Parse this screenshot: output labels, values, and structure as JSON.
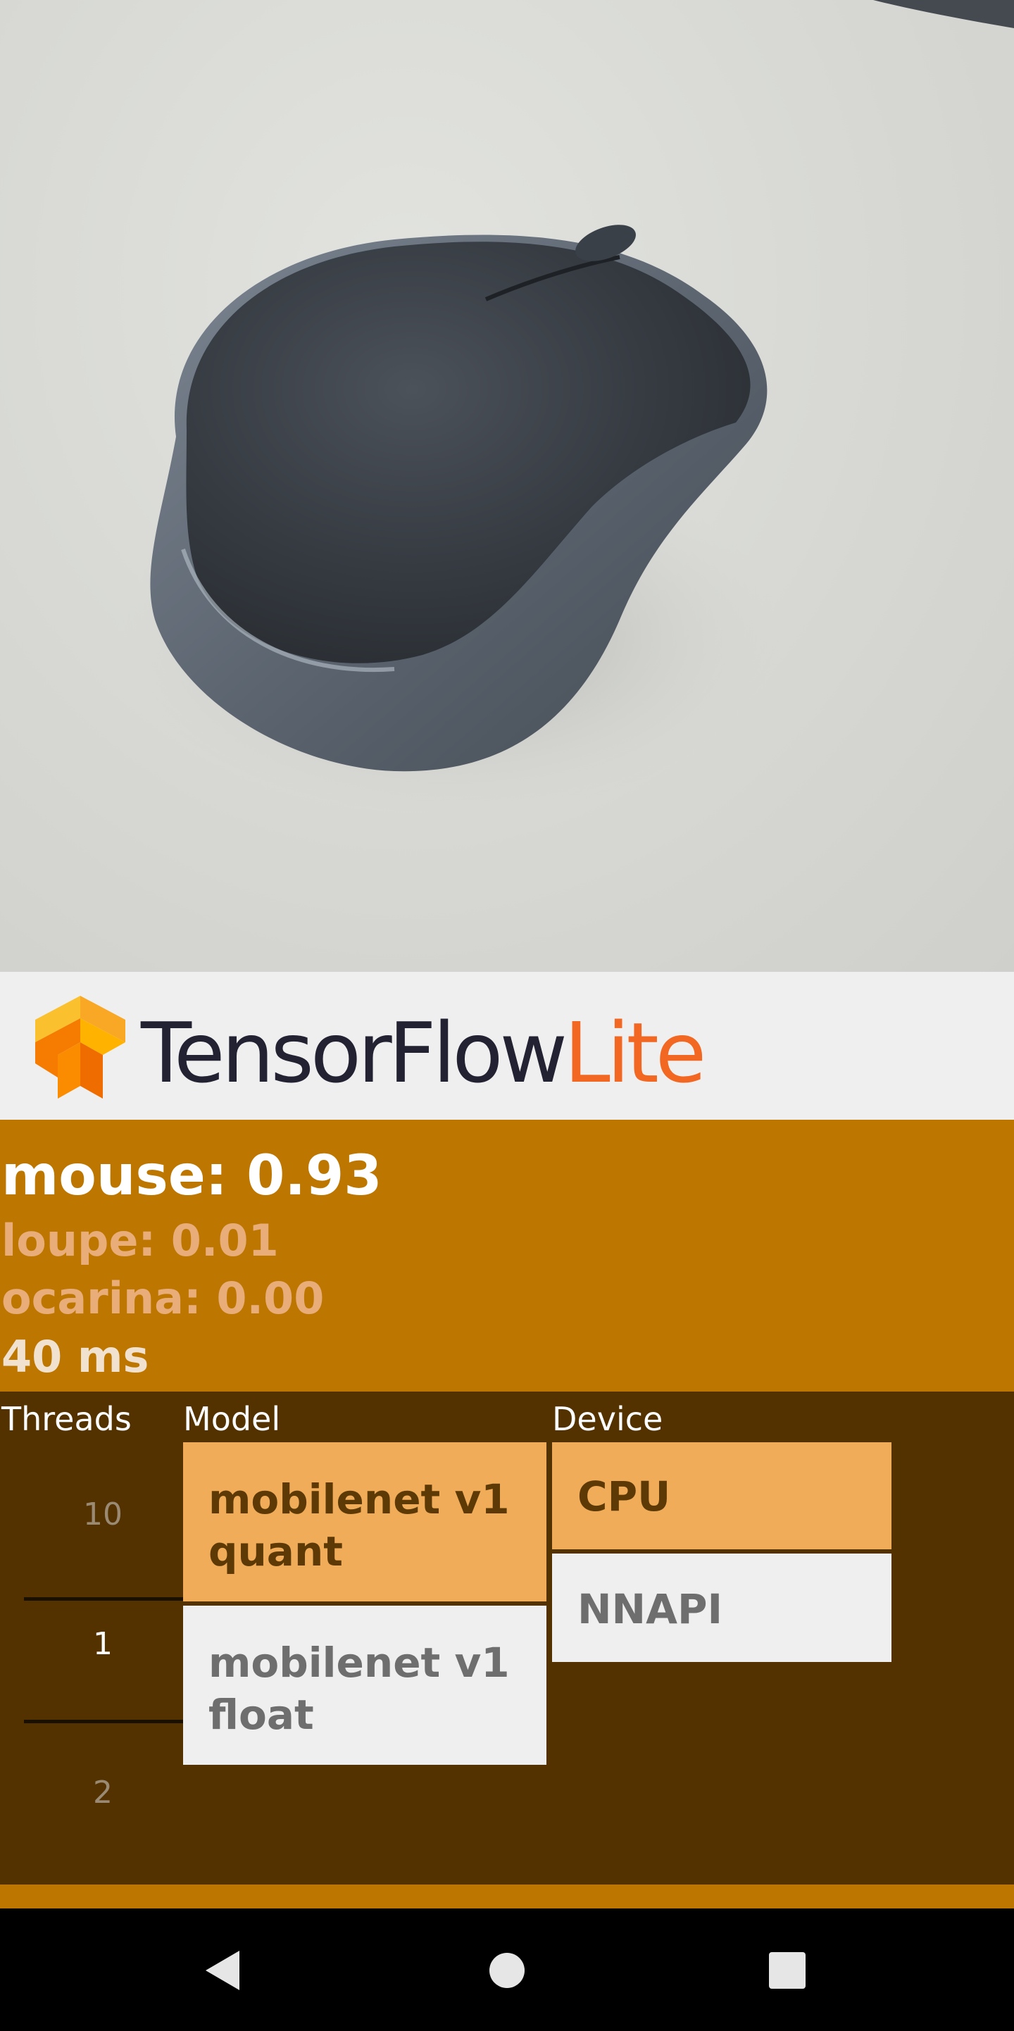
{
  "camera": {
    "subject": "computer-mouse"
  },
  "header": {
    "brand_primary": "TensorFlow",
    "brand_secondary": "Lite",
    "logo_icon": "tensorflow-logo-icon"
  },
  "results": {
    "top": "mouse: 0.93",
    "second": "loupe: 0.01",
    "third": "ocarina: 0.00",
    "inference_time": "40 ms"
  },
  "controls": {
    "threads": {
      "label": "Threads",
      "values": [
        "10",
        "1",
        "2"
      ],
      "selected": "1"
    },
    "model": {
      "label": "Model",
      "options": [
        "mobilenet v1 quant",
        "mobilenet v1 float"
      ],
      "selected": "mobilenet v1 quant"
    },
    "device": {
      "label": "Device",
      "options": [
        "CPU",
        "NNAPI"
      ],
      "selected": "CPU"
    }
  },
  "nav": {
    "back": "back-icon",
    "home": "home-icon",
    "recents": "recents-icon"
  },
  "colors": {
    "accent": "#bd7700",
    "panel": "#533200",
    "selected": "#f0ac58",
    "brand_orange": "#f26722"
  }
}
